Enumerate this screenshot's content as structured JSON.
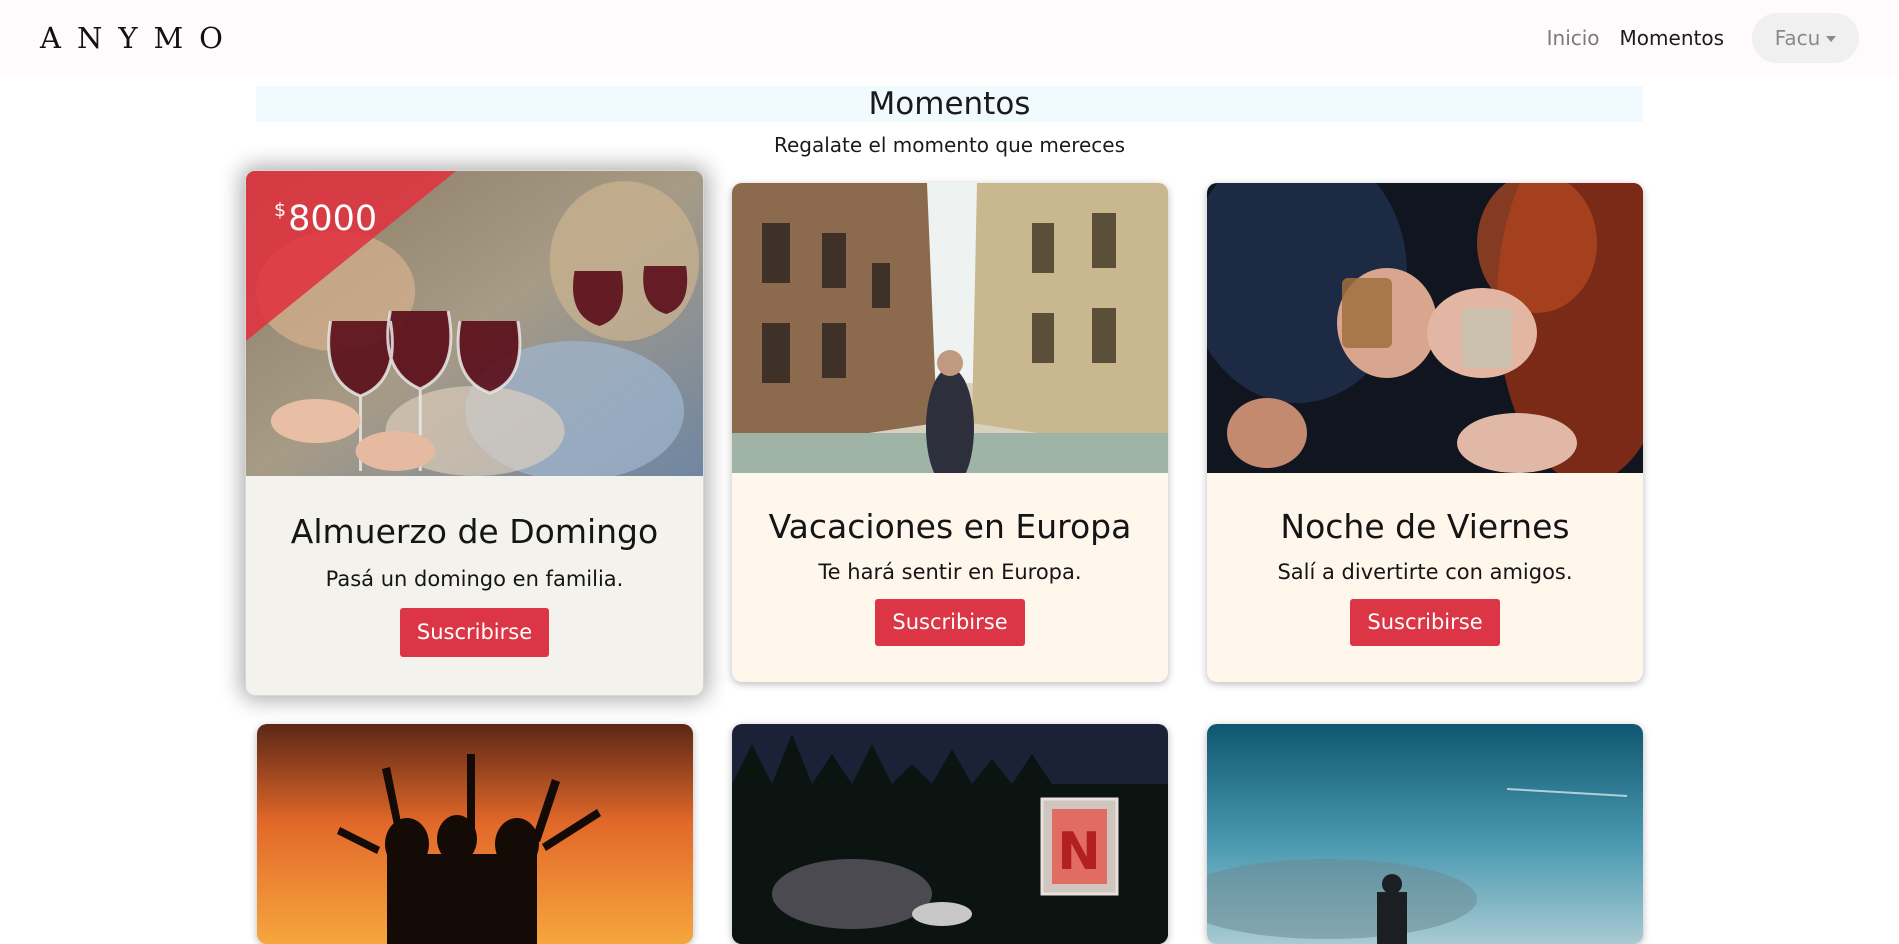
{
  "brand": "ANYMO",
  "nav": {
    "items": [
      {
        "label": "Inicio",
        "active": false
      },
      {
        "label": "Momentos",
        "active": true
      }
    ],
    "user_menu": "Facu"
  },
  "header": {
    "title": "Momentos",
    "subtitle": "Regalate el momento que mereces"
  },
  "cards": [
    {
      "title": "Almuerzo de Domingo",
      "text": "Pasá un domingo en familia.",
      "button": "Suscribirse",
      "price_currency": "$",
      "price_value": "8000",
      "featured": true
    },
    {
      "title": "Vacaciones en Europa",
      "text": "Te hará sentir en Europa.",
      "button": "Suscribirse"
    },
    {
      "title": "Noche de Viernes",
      "text": "Salí a divertirte con amigos.",
      "button": "Suscribirse"
    },
    {
      "image": "sunset-party-silhouettes"
    },
    {
      "image": "outdoor-cinema-night"
    },
    {
      "image": "blue-sky-horizon"
    }
  ],
  "colors": {
    "accent": "#dc3545",
    "card_bg": "#fff6ec",
    "featured_bg": "#f3f2ed",
    "header_bg": "#f1fbff",
    "nav_bg": "#fffbfc"
  }
}
